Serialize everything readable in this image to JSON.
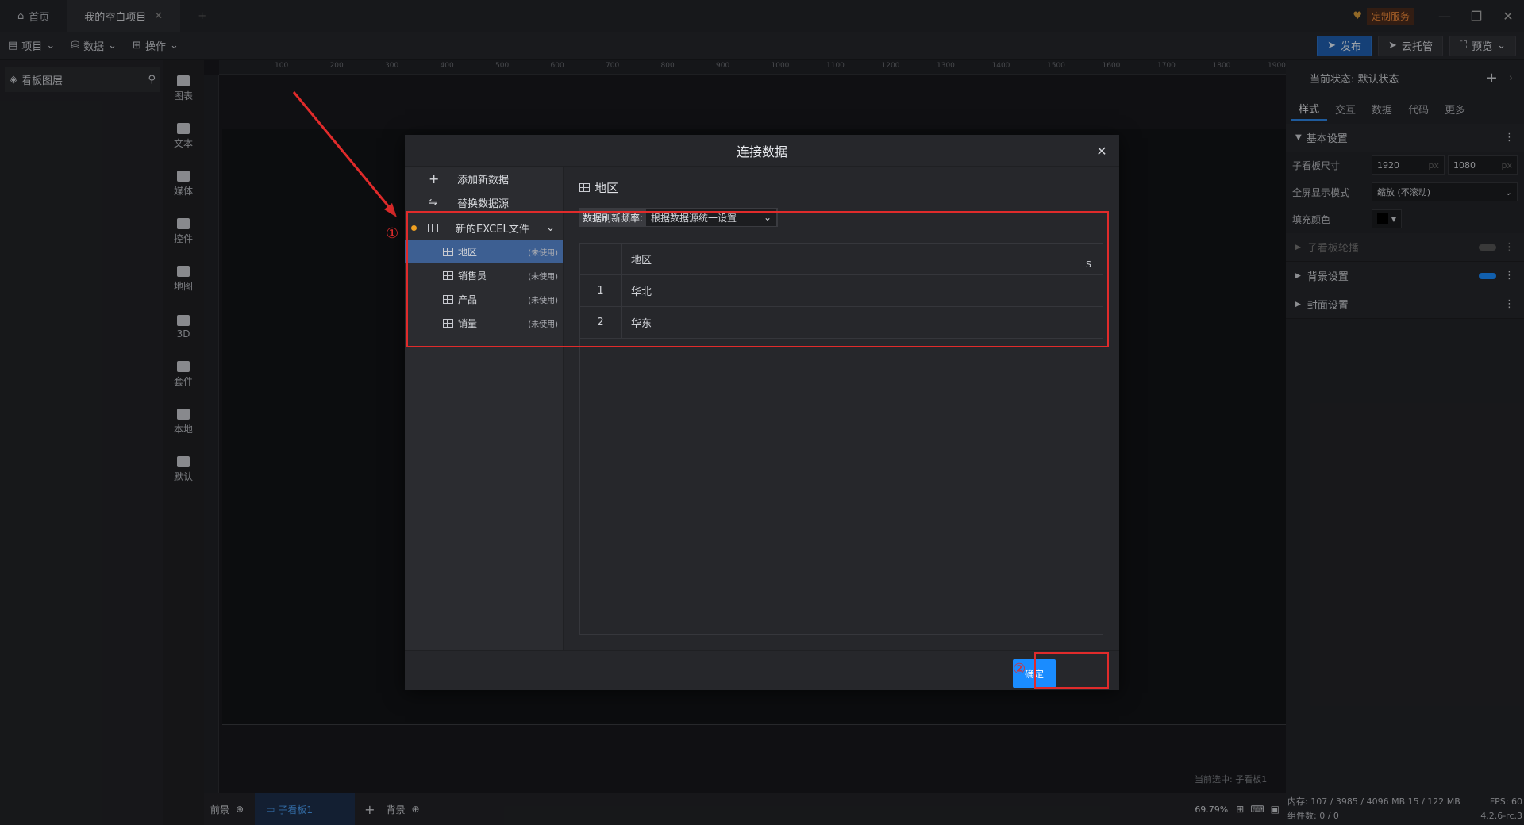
{
  "titlebar": {
    "home_tab": "首页",
    "project_tab": "我的空白项目",
    "custom_service": "定制服务"
  },
  "toolbar": {
    "project": "项目",
    "data": "数据",
    "operate": "操作",
    "publish": "发布",
    "cloud": "云托管",
    "preview": "预览"
  },
  "leftpanel": {
    "title": "看板图层"
  },
  "iconbar": [
    {
      "label": "图表",
      "icon": "bar-chart-icon"
    },
    {
      "label": "文本",
      "icon": "text-icon"
    },
    {
      "label": "媒体",
      "icon": "media-icon"
    },
    {
      "label": "控件",
      "icon": "widget-icon"
    },
    {
      "label": "地图",
      "icon": "map-icon"
    },
    {
      "label": "3D",
      "icon": "cube-icon"
    },
    {
      "label": "套件",
      "icon": "shirt-icon"
    },
    {
      "label": "本地",
      "icon": "puzzle-icon"
    },
    {
      "label": "默认",
      "icon": "bar-chart-icon"
    }
  ],
  "ruler": {
    "h_ticks": [
      "100",
      "200",
      "300",
      "400",
      "500",
      "600",
      "700",
      "800",
      "900",
      "1000",
      "1100",
      "1200",
      "1300",
      "1400",
      "1500",
      "1600",
      "1700",
      "1800",
      "1900"
    ]
  },
  "bottombar": {
    "front": "前景",
    "board": "子看板1",
    "back": "背景",
    "zoom": "69.79%",
    "current_selected": "当前选中: 子看板1"
  },
  "rightpanel": {
    "state": "当前状态: 默认状态",
    "tabs": [
      "样式",
      "交互",
      "数据",
      "代码",
      "更多"
    ],
    "basic": "基本设置",
    "size_label": "子看板尺寸",
    "width": "1920",
    "height": "1080",
    "unit": "px",
    "fullscreen_label": "全屏显示模式",
    "fullscreen_value": "缩放 (不滚动)",
    "fill_label": "填充颜色",
    "fill_color": "#000000",
    "carousel": "子看板轮播",
    "background": "背景设置",
    "cover": "封面设置",
    "memory": "内存: 107 / 3985 / 4096 MB 15 / 122 MB",
    "fps": "FPS: 60",
    "components": "组件数: 0 / 0",
    "version": "4.2.6-rc.3"
  },
  "modal": {
    "title": "连接数据",
    "add": "添加新数据",
    "replace": "替换数据源",
    "file": "新的EXCEL文件",
    "sheets": [
      {
        "name": "地区",
        "badge": "(未使用)"
      },
      {
        "name": "销售员",
        "badge": "(未使用)"
      },
      {
        "name": "产品",
        "badge": "(未使用)"
      },
      {
        "name": "销量",
        "badge": "(未使用)"
      }
    ],
    "sheet_title": "地区",
    "refresh_label": "数据刷新频率:",
    "refresh_value": "根据数据源统一设置",
    "column": "地区",
    "column_type": "S",
    "rows": [
      {
        "idx": "1",
        "value": "华北"
      },
      {
        "idx": "2",
        "value": "华东"
      }
    ],
    "confirm": "确定",
    "marker1": "①",
    "marker2": "②"
  },
  "colors": {
    "accent": "#1a8cff",
    "highlight": "#e02b2b",
    "selected_row": "#3d5f92"
  }
}
